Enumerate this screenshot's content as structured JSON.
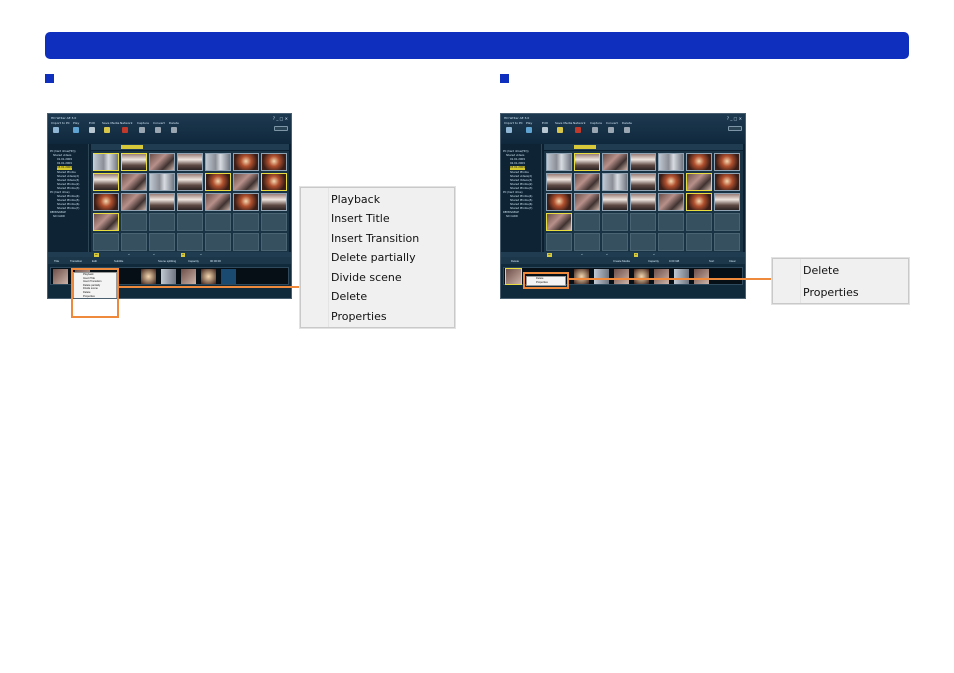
{
  "left_shot": {
    "app_title": "HD Writer AE 3.0",
    "toolbar": [
      "Import to PC",
      "Play",
      "Edit",
      "Save Media",
      "Network",
      "Capture",
      "Convert",
      "Delete"
    ],
    "tree": [
      "PC (hard drive(HD))",
      "Shared videos",
      "01.01.2009",
      "02.01.2009",
      "03.01.2009",
      "Shared Photos",
      "Shared videos(2)",
      "Shared Videos(3)",
      "Shared Photos(2)",
      "Shared Photos(3)",
      "PC (hard drive)",
      "Shared Photos(4)",
      "Shared Photos(5)",
      "Shared Photos(6)",
      "Shared Photos(7)",
      "REMOVABLE",
      "SD CARD"
    ],
    "storyboard_tools": [
      "Title",
      "Transition",
      "Edit",
      "Subtitle",
      "Scene splitting",
      "Capacity",
      "00:00:00"
    ],
    "mini_menu": [
      "Playback",
      "Insert Title",
      "Insert Transition",
      "Delete partially",
      "Divide scene",
      "Delete",
      "Properties"
    ]
  },
  "right_shot": {
    "app_title": "HD Writer AE 3.0",
    "toolbar": [
      "Import to PC",
      "Play",
      "Edit",
      "Save Media",
      "Network",
      "Capture",
      "Convert",
      "Delete"
    ],
    "storyboard_tools": [
      "Delete",
      "Create Media",
      "Capacity",
      "0.00 GB",
      "Sort",
      "Clear"
    ],
    "mini_menu": [
      "Delete",
      "Properties"
    ]
  },
  "left_menu": {
    "items": [
      "Playback",
      "Insert Title",
      "Insert Transition",
      "Delete partially",
      "Divide scene",
      "Delete",
      "Properties"
    ]
  },
  "right_menu": {
    "items": [
      "Delete",
      "Properties"
    ]
  },
  "colors": {
    "header": "#0f2fbf",
    "highlight": "#ef8a3c",
    "app_bg": "#0c1f30",
    "selection": "#d4c72c"
  }
}
